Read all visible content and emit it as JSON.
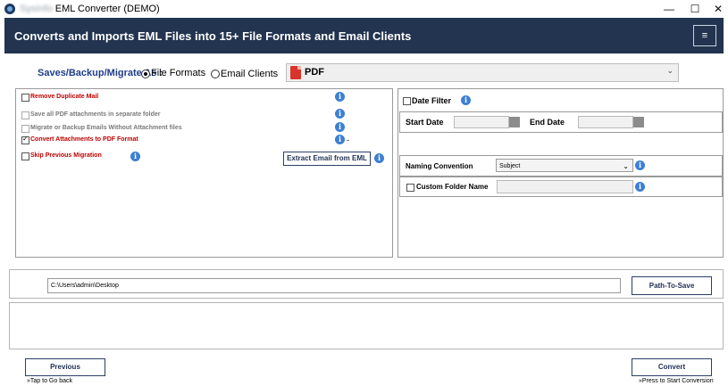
{
  "window": {
    "title": "EML Converter (DEMO)",
    "title_prefix_blurred": "SysInfo",
    "min_glyph": "—",
    "max_glyph": "☐",
    "close_glyph": "✕"
  },
  "header": {
    "title": "Converts and Imports EML Files into 15+ File Formats and Email Clients",
    "menu_glyph": "≡"
  },
  "save_as": {
    "label": "Saves/Backup/Migrate As :",
    "options": [
      {
        "label": "File Formats",
        "selected": true
      },
      {
        "label": "Email Clients",
        "selected": false
      }
    ],
    "format_value": "PDF",
    "chevron": "⌄"
  },
  "left_panel": {
    "options": [
      {
        "label": "Remove Duplicate Mail",
        "checked": false,
        "enabled": true
      },
      {
        "label": "Save all PDF attachments in separate folder",
        "checked": false,
        "enabled": false
      },
      {
        "label": "Migrate or Backup Emails Without Attachment files",
        "checked": false,
        "enabled": false
      },
      {
        "label": "Convert Attachments to PDF Format",
        "checked": true,
        "enabled": true
      },
      {
        "label": "Skip Previous Migration",
        "checked": false,
        "enabled": true
      }
    ],
    "info_glyph": "i",
    "dash": "-",
    "extract_button": "Extract Email from EML"
  },
  "right_panel": {
    "date_filter_label": "Date Filter",
    "start_date_label": "Start Date",
    "end_date_label": "End Date",
    "naming_convention_label": "Naming Convention",
    "naming_convention_value": "Subject",
    "custom_folder_label": "Custom Folder Name",
    "custom_folder_value": ""
  },
  "path": {
    "value": "C:\\Users\\admin\\Desktop",
    "button": "Path-To-Save"
  },
  "footer": {
    "previous_button": "Previous",
    "previous_hint": "»Tap to Go back",
    "convert_button": "Convert",
    "convert_hint": "»Press to Start Conversion"
  },
  "colors": {
    "header_bg": "#22344f",
    "accent_blue": "#1f3d8a",
    "warning_red": "#c00000",
    "info_blue": "#3d7fd3"
  }
}
